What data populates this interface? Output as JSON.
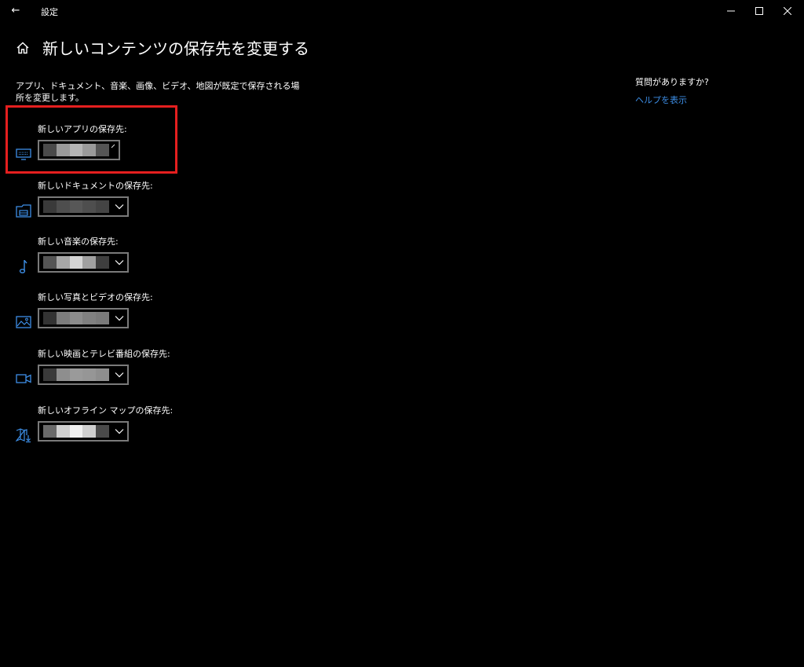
{
  "window": {
    "title": "設定",
    "back_glyph": "←"
  },
  "header": {
    "title": "新しいコンテンツの保存先を変更する"
  },
  "description": "アプリ、ドキュメント、音楽、画像、ビデオ、地図が既定で保存される場所を変更します。",
  "help": {
    "question": "質問がありますか?",
    "link": "ヘルプを表示"
  },
  "locations": [
    {
      "label": "新しいアプリの保存先:",
      "icon": "monitor-icon"
    },
    {
      "label": "新しいドキュメントの保存先:",
      "icon": "drive-icon"
    },
    {
      "label": "新しい音楽の保存先:",
      "icon": "music-note-icon"
    },
    {
      "label": "新しい写真とビデオの保存先:",
      "icon": "picture-icon"
    },
    {
      "label": "新しい映画とテレビ番組の保存先:",
      "icon": "video-camera-icon"
    },
    {
      "label": "新しいオフライン マップの保存先:",
      "icon": "map-download-icon"
    }
  ],
  "colors": {
    "accent": "#3d8ee6",
    "highlight": "#e51f1f",
    "background": "#000000"
  }
}
